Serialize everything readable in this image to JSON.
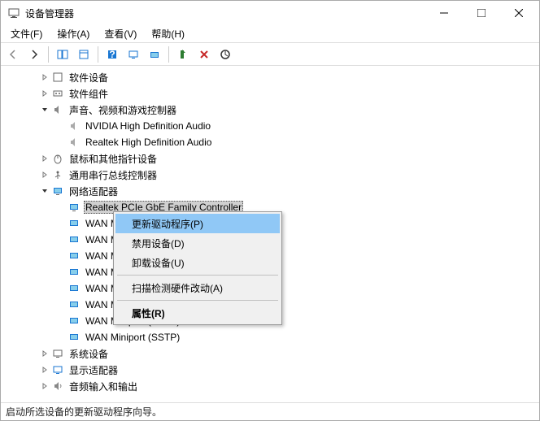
{
  "window": {
    "title": "设备管理器"
  },
  "menus": {
    "file": "文件(F)",
    "action": "操作(A)",
    "view": "查看(V)",
    "help": "帮助(H)"
  },
  "tree": {
    "n_software_devices": "软件设备",
    "n_software_components": "软件组件",
    "n_sound": "声音、视频和游戏控制器",
    "n_nvidia_audio": "NVIDIA High Definition Audio",
    "n_realtek_audio": "Realtek High Definition Audio",
    "n_mice": "鼠标和其他指针设备",
    "n_usb": "通用串行总线控制器",
    "n_network": "网络适配器",
    "n_realtek_nic": "Realtek PCIe GbE Family Controller",
    "n_wan1": "WAN Mi",
    "n_wan2": "WAN Mi",
    "n_wan3": "WAN Mi",
    "n_wan4": "WAN Mi",
    "n_wan5": "WAN Mi",
    "n_wan6": "WAN Mi",
    "n_wan_pptp": "WAN Miniport (PPTP)",
    "n_wan_sstp": "WAN Miniport (SSTP)",
    "n_system": "系统设备",
    "n_display": "显示适配器",
    "n_audio_io": "音频输入和输出"
  },
  "context_menu": {
    "update_driver": "更新驱动程序(P)",
    "disable": "禁用设备(D)",
    "uninstall": "卸载设备(U)",
    "scan": "扫描检测硬件改动(A)",
    "properties": "属性(R)"
  },
  "status": "启动所选设备的更新驱动程序向导。"
}
